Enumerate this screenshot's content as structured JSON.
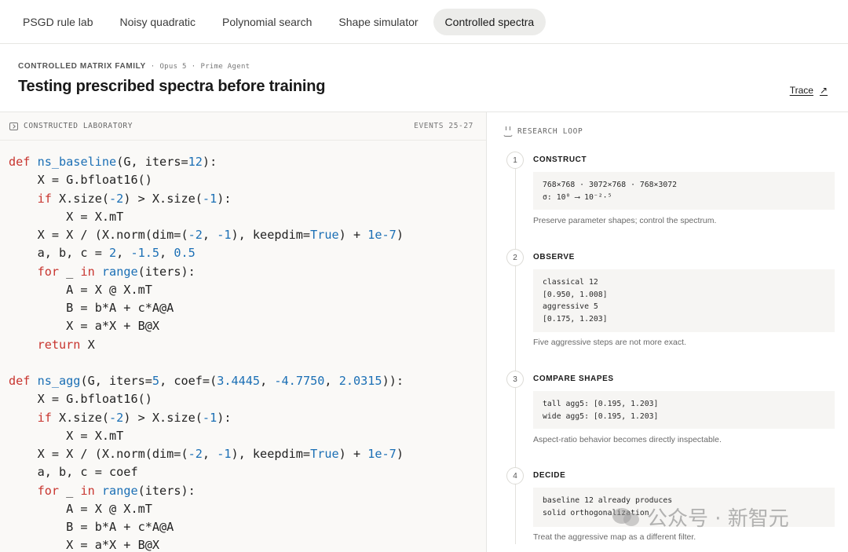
{
  "tabs": [
    {
      "label": "PSGD rule lab",
      "active": false
    },
    {
      "label": "Noisy quadratic",
      "active": false
    },
    {
      "label": "Polynomial search",
      "active": false
    },
    {
      "label": "Shape simulator",
      "active": false
    },
    {
      "label": "Controlled spectra",
      "active": true
    }
  ],
  "header": {
    "eyebrow": "CONTROLLED MATRIX FAMILY",
    "sep1": "·",
    "model": "Opus 5",
    "sep2": "·",
    "agent": "Prime Agent",
    "title": "Testing prescribed spectra before training",
    "trace_label": "Trace",
    "trace_icon": "arrow-up-right-icon"
  },
  "left": {
    "label": "CONSTRUCTED LABORATORY",
    "events": "EVENTS 25-27"
  },
  "right": {
    "label": "RESEARCH LOOP",
    "steps": [
      {
        "num": "1",
        "title": "CONSTRUCT",
        "lines": [
          "768×768 · 3072×768 · 768×3072",
          "σ: 10⁰ ⟶ 10⁻²·⁵"
        ],
        "note": "Preserve parameter shapes; control the spectrum."
      },
      {
        "num": "2",
        "title": "OBSERVE",
        "lines": [
          "classical 12",
          "[0.950, 1.008]",
          "aggressive 5",
          "[0.175, 1.203]"
        ],
        "note": "Five aggressive steps are not more exact."
      },
      {
        "num": "3",
        "title": "COMPARE SHAPES",
        "lines": [
          "tall agg5: [0.195, 1.203]",
          "wide agg5: [0.195, 1.203]"
        ],
        "note": "Aspect-ratio behavior becomes directly inspectable."
      },
      {
        "num": "4",
        "title": "DECIDE",
        "lines": [
          "baseline 12 already produces",
          "solid orthogonalization"
        ],
        "note": "Treat the aggressive map as a different filter."
      }
    ]
  },
  "watermark": "公众号 · 新智元"
}
